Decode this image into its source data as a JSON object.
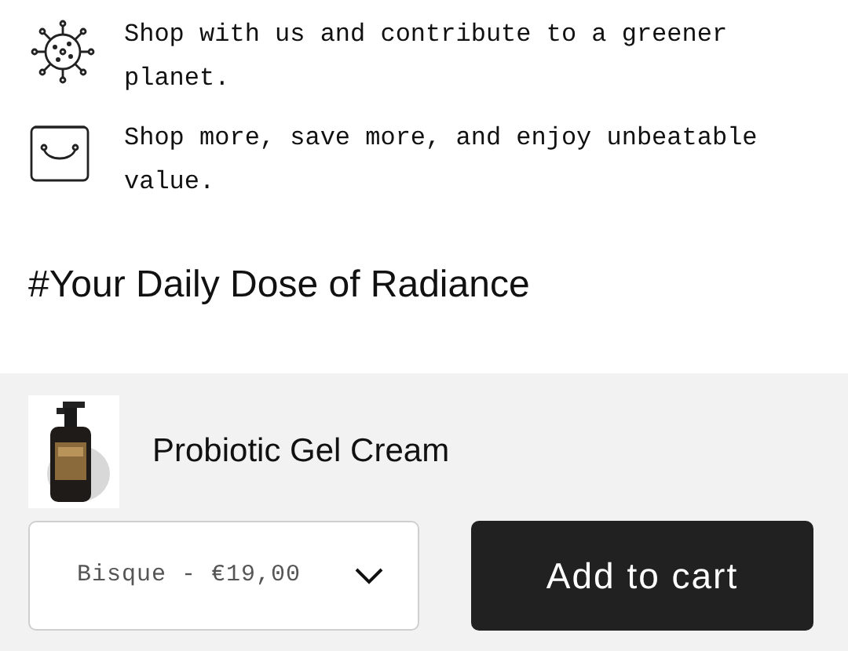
{
  "features": [
    {
      "kind": "virus",
      "text": "Shop with us and contribute to a greener planet."
    },
    {
      "kind": "bag",
      "text": "Shop more, save more, and enjoy unbeatable value."
    }
  ],
  "heading": "#Your Daily Dose of Radiance",
  "sticky_bar": {
    "product": {
      "title": "Probiotic Gel Cream"
    },
    "variant_select": {
      "value": "Bisque - €19,00"
    },
    "add_button": "Add to cart"
  }
}
